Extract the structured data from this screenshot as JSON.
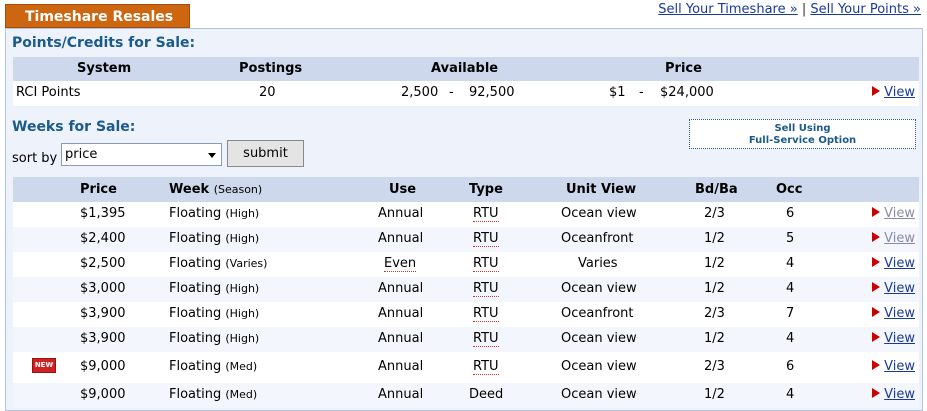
{
  "header": {
    "tab_label": "Timeshare Resales",
    "link_sell_timeshare": "Sell Your Timeshare »",
    "separator": "|",
    "link_sell_points": "Sell Your Points »"
  },
  "points_section": {
    "title": "Points/Credits for Sale:",
    "columns": {
      "system": "System",
      "postings": "Postings",
      "available": "Available",
      "price": "Price"
    },
    "row": {
      "system": "RCI Points",
      "postings": "20",
      "available_min": "2,500",
      "available_dash": "-",
      "available_max": "92,500",
      "price_min": "$1",
      "price_dash": "-",
      "price_max": "$24,000",
      "view": "View"
    }
  },
  "weeks_section": {
    "title": "Weeks for Sale:",
    "sell_button_line1": "Sell Using",
    "sell_button_line2": "Full-Service Option",
    "sort_label": "sort by",
    "sort_value": "price",
    "submit_label": "submit",
    "new_badge": "NEW",
    "columns": {
      "price": "Price",
      "week": "Week",
      "season": "(Season)",
      "use": "Use",
      "type": "Type",
      "unit_view": "Unit View",
      "bdba": "Bd/Ba",
      "occ": "Occ"
    },
    "rows": [
      {
        "price": "$1,395",
        "week": "Floating",
        "season": "(High)",
        "use": "Annual",
        "type": "RTU",
        "view_desc": "Ocean view",
        "bdba": "2/3",
        "occ": "6",
        "link": "View"
      },
      {
        "price": "$2,400",
        "week": "Floating",
        "season": "(High)",
        "use": "Annual",
        "type": "RTU",
        "view_desc": "Oceanfront",
        "bdba": "1/2",
        "occ": "5",
        "link": "View"
      },
      {
        "price": "$2,500",
        "week": "Floating",
        "season": "(Varies)",
        "use": "Even",
        "type": "RTU",
        "view_desc": "Varies",
        "bdba": "1/2",
        "occ": "4",
        "link": "View"
      },
      {
        "price": "$3,000",
        "week": "Floating",
        "season": "(High)",
        "use": "Annual",
        "type": "RTU",
        "view_desc": "Ocean view",
        "bdba": "1/2",
        "occ": "4",
        "link": "View"
      },
      {
        "price": "$3,900",
        "week": "Floating",
        "season": "(High)",
        "use": "Annual",
        "type": "RTU",
        "view_desc": "Oceanfront",
        "bdba": "2/3",
        "occ": "7",
        "link": "View"
      },
      {
        "price": "$3,900",
        "week": "Floating",
        "season": "(High)",
        "use": "Annual",
        "type": "RTU",
        "view_desc": "Ocean view",
        "bdba": "1/2",
        "occ": "4",
        "link": "View"
      },
      {
        "price": "$9,000",
        "week": "Floating",
        "season": "(Med)",
        "use": "Annual",
        "type": "RTU",
        "view_desc": "Ocean view",
        "bdba": "2/3",
        "occ": "6",
        "link": "View"
      },
      {
        "price": "$9,000",
        "week": "Floating",
        "season": "(Med)",
        "use": "Annual",
        "type": "Deed",
        "view_desc": "Ocean view",
        "bdba": "1/2",
        "occ": "4",
        "link": "View"
      }
    ]
  },
  "colors": {
    "tab": "#cc6611",
    "section_title": "#1a5a8c",
    "header_row": "#cdd8ec",
    "link": "#1a3a9a",
    "arrow": "#cc0000"
  }
}
